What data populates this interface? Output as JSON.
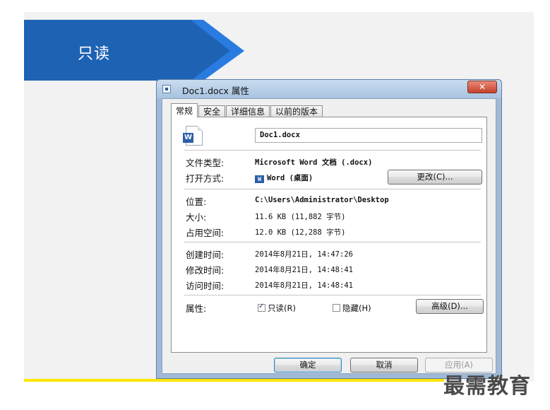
{
  "slide": {
    "banner_label": "只读",
    "watermark": "最需教育",
    "colors": {
      "banner_dark": "#1e62b4",
      "banner_light": "#2a7be0",
      "accent_line": "#ffe500"
    }
  },
  "dialog": {
    "title": "Doc1.docx 属性",
    "close_symbol": "✕",
    "tabs": [
      {
        "label": "常规",
        "active": true
      },
      {
        "label": "安全"
      },
      {
        "label": "详细信息"
      },
      {
        "label": "以前的版本"
      }
    ],
    "file_name": "Doc1.docx",
    "file_icon": "word-document-icon",
    "rows": {
      "type_label": "文件类型:",
      "type_value": "Microsoft Word 文档 (.docx)",
      "opens_with_label": "打开方式:",
      "opens_with_value": "Word (桌面)",
      "change_button": "更改(C)...",
      "location_label": "位置:",
      "location_value": "C:\\Users\\Administrator\\Desktop",
      "size_label": "大小:",
      "size_value": "11.6 KB (11,882 字节)",
      "disk_size_label": "占用空间:",
      "disk_size_value": "12.0 KB (12,288 字节)",
      "created_label": "创建时间:",
      "created_value": "2014年8月21日, 14:47:26",
      "modified_label": "修改时间:",
      "modified_value": "2014年8月21日, 14:48:41",
      "accessed_label": "访问时间:",
      "accessed_value": "2014年8月21日, 14:48:41",
      "attributes_label": "属性:",
      "readonly_label": "只读(R)",
      "readonly_checked": true,
      "hidden_label": "隐藏(H)",
      "hidden_checked": false,
      "advanced_button": "高级(D)..."
    },
    "buttons": {
      "ok": "确定",
      "cancel": "取消",
      "apply": "应用(A)"
    }
  }
}
